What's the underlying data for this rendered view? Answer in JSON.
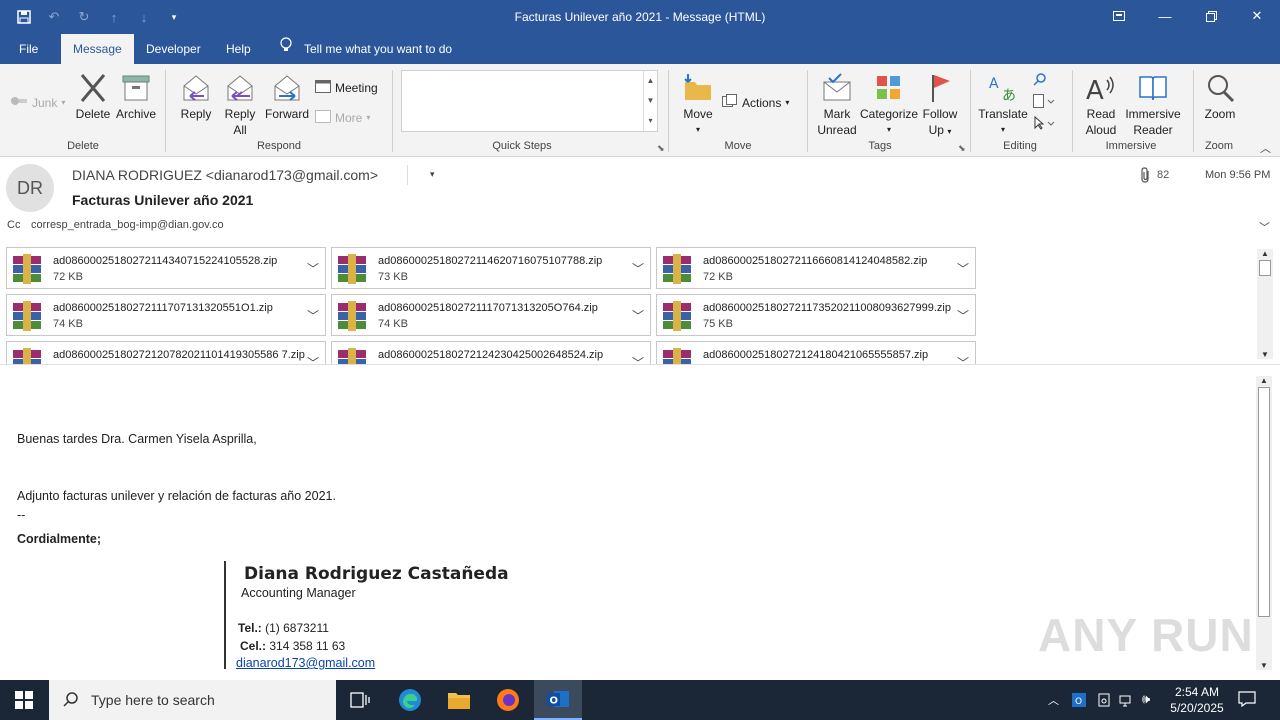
{
  "window": {
    "title": "Facturas Unilever año 2021  -  Message (HTML)"
  },
  "menu": {
    "tabs": [
      "File",
      "Message",
      "Developer",
      "Help"
    ],
    "tell_me": "Tell me what you want to do"
  },
  "ribbon": {
    "junk": "Junk",
    "delete": "Delete",
    "archive": "Archive",
    "group_delete": "Delete",
    "reply": "Reply",
    "reply_all_1": "Reply",
    "reply_all_2": "All",
    "forward": "Forward",
    "meeting": "Meeting",
    "more": "More",
    "group_respond": "Respond",
    "group_quick_steps": "Quick Steps",
    "move": "Move",
    "actions": "Actions",
    "group_move": "Move",
    "mark_unread_1": "Mark",
    "mark_unread_2": "Unread",
    "categorize": "Categorize",
    "follow_up_1": "Follow",
    "follow_up_2": "Up",
    "group_tags": "Tags",
    "translate": "Translate",
    "group_editing": "Editing",
    "read_aloud_1": "Read",
    "read_aloud_2": "Aloud",
    "immersive_1": "Immersive",
    "immersive_2": "Reader",
    "group_immersive": "Immersive",
    "zoom": "Zoom",
    "group_zoom": "Zoom"
  },
  "message": {
    "avatar_initials": "DR",
    "from": "DIANA RODRIGUEZ <dianarod173@gmail.com>",
    "subject": "Facturas Unilever año 2021",
    "cc_label": "Cc",
    "cc": "corresp_entrada_bog-imp@dian.gov.co",
    "attachment_count": "82",
    "time": "Mon 9:56 PM"
  },
  "attachments": [
    {
      "name": "ad08600025180272114340715224105528.zip",
      "size": "72 KB"
    },
    {
      "name": "ad08600025180272114620716075107788.zip",
      "size": "73 KB"
    },
    {
      "name": "ad08600025180272116660814124048582.zip",
      "size": "72 KB"
    },
    {
      "name": "ad08600025180272111707131320551O1.zip",
      "size": "74 KB"
    },
    {
      "name": "ad086000251802721117071313205O764.zip",
      "size": "74 KB"
    },
    {
      "name": "ad086000251802721173520211008093627999.zip",
      "size": "75 KB"
    },
    {
      "name": "ad08600025180272120782021101419305586 7.zip",
      "size": ""
    },
    {
      "name": "ad08600025180272124230425002648524.zip",
      "size": ""
    },
    {
      "name": "ad08600025180272124180421065555857.zip",
      "size": ""
    }
  ],
  "body": {
    "greeting": "Buenas tardes Dra. Carmen Yisela Asprilla,",
    "line1": "Adjunto facturas unilever y relación de facturas año 2021.",
    "dashes": "--",
    "closing": "Cordialmente;",
    "sig_name": "Diana Rodriguez Castañeda",
    "sig_title": "Accounting Manager",
    "tel_label": "Tel.:",
    "tel": " (1) 6873211",
    "cel_label": "Cel.:",
    "cel": " 314  358  11 63",
    "email": "dianarod173@gmail.com"
  },
  "taskbar": {
    "search_placeholder": "Type here to search",
    "time": "2:54 AM",
    "date": "5/20/2025"
  },
  "watermark": "ANY RUN",
  "colors": {
    "accent": "#2b579a",
    "taskbar": "#1b2737"
  }
}
